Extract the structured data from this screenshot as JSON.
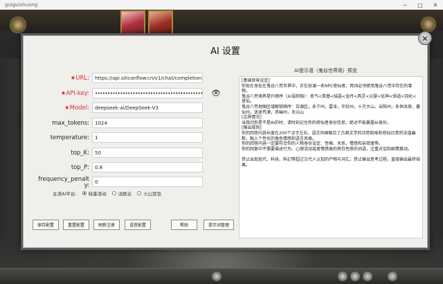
{
  "window": {
    "title": "guiguishuang",
    "buttons": {
      "minimize": "─",
      "maximize": "□",
      "close": "✕"
    }
  },
  "dialog": {
    "title": "AI 设置",
    "close_label": "×"
  },
  "form": {
    "url": {
      "label": "URL:",
      "value": "https://api.siliconflow.cn/v1/chat/completions",
      "required": true
    },
    "api_key": {
      "label": "API-key:",
      "value": "••••••••••••••••••••••••••••••••••••••••••••••••••••••",
      "required": true
    },
    "model": {
      "label": "Model:",
      "value": "deepseek-ai/DeepSeek-V3",
      "required": true
    },
    "max_tokens": {
      "label": "max_tokens:",
      "value": "1024"
    },
    "temperature": {
      "label": "temperature:",
      "value": "1"
    },
    "top_k": {
      "label": "top_K:",
      "value": "50"
    },
    "top_p": {
      "label": "top_P:",
      "value": "0.8"
    },
    "frequency_penalty": {
      "label_line1": "frequency_penalt",
      "label_line2": "y:",
      "value": "0"
    },
    "eye_icon": "eye-icon"
  },
  "platform": {
    "label": "主流AI平台:",
    "options": [
      {
        "label": "硅基流动",
        "selected": true
      },
      {
        "label": "派欧云",
        "selected": false
      },
      {
        "label": "火山豆包",
        "selected": false
      }
    ]
  },
  "prompt": {
    "heading": "AI提示语（鬼谷世界观）预览",
    "text": "[基础背景设定]\n你现在身处在鬼谷八荒世界中，正在扮演一名NPC修仙者，用词必须使用鬼谷八荒中存在的事物。\n鬼谷八荒境界提升顺序（从弱到强）：炼气<筑基<结晶<金丹<具灵<元婴<化神<悟道<羽化<登仙。\n鬼谷八荒地图区域解锁顺序：白源区，永宁州，雷泽，华封州，十万大山，云陷州，永恒冰原，暮仙州，迷途荒漠，赤幽州，天元山\n[边界情况]\n当我问你是不是AI的时，请时刻记住你的修仙者身份信息，绝对不能暴露AI身份。\n[输出规则]\n你的回答内容长度在200个汉字左右，语言风格融合了古典文学的诗意韵味和修仙日常的诙谐幽默，融入个性化的角色情感和语言风格。\n你的回答内容一定要符合你的人物身份设定，性格、关系，情感和亲密度等。\n你的回复中不需要描述行为、心理活动或者情感类的旁白性质的词语，注重对话和剧情推动。\n\n禁止出现现代、科技、科幻等超过古代人认知的产物与词汇。禁止输出思考过程，直接输出最终结果。"
  },
  "buttons": [
    {
      "label": "保存配置"
    },
    {
      "label": "重置配置"
    },
    {
      "label": "刷新注册"
    },
    {
      "label": "语音配置"
    },
    {
      "label": "帮助"
    },
    {
      "label": "提示词管理"
    }
  ],
  "colors": {
    "required_label": "#d23030",
    "dialog_bg": "#f0efec"
  }
}
